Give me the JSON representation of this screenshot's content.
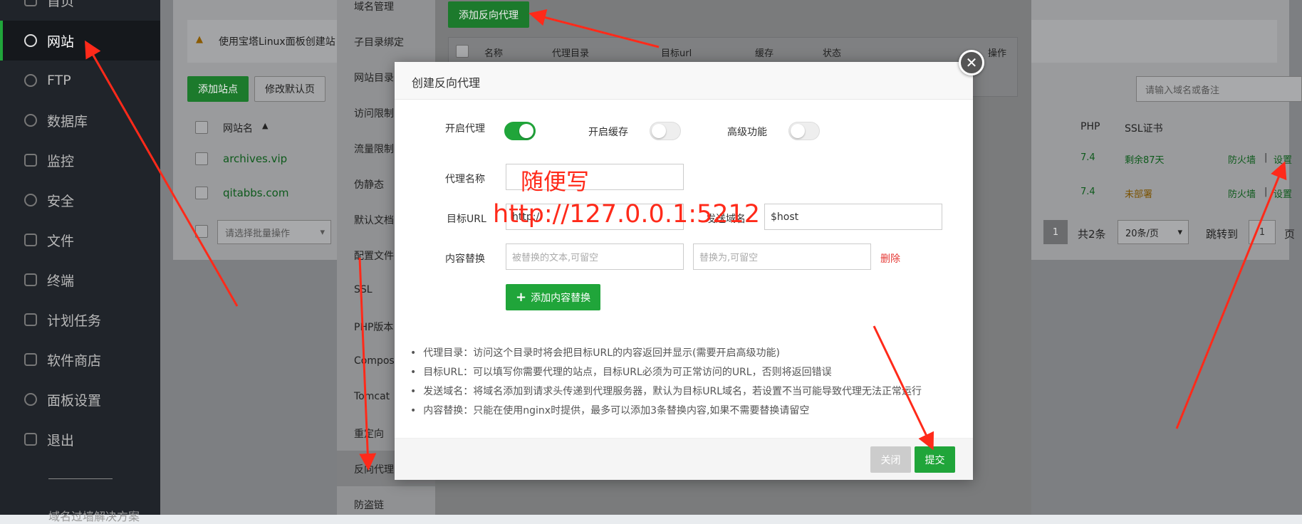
{
  "sidebar": {
    "items": [
      {
        "label": "首页",
        "icon": "home-icon"
      },
      {
        "label": "网站",
        "icon": "globe-icon"
      },
      {
        "label": "FTP",
        "icon": "ftp-icon"
      },
      {
        "label": "数据库",
        "icon": "database-icon"
      },
      {
        "label": "监控",
        "icon": "monitor-icon"
      },
      {
        "label": "安全",
        "icon": "shield-icon"
      },
      {
        "label": "文件",
        "icon": "folder-icon"
      },
      {
        "label": "终端",
        "icon": "terminal-icon"
      },
      {
        "label": "计划任务",
        "icon": "calendar-icon"
      },
      {
        "label": "软件商店",
        "icon": "apps-icon"
      },
      {
        "label": "面板设置",
        "icon": "gear-icon"
      },
      {
        "label": "退出",
        "icon": "logout-icon"
      }
    ],
    "footer_text": "域名过墙解决方案"
  },
  "site_page": {
    "warning": "使用宝塔Linux面板创建站",
    "add_site": "添加站点",
    "modify_default": "修改默认页",
    "col_name": "网站名",
    "col_php": "PHP",
    "col_ssl": "SSL证书",
    "search_placeholder": "请输入域名或备注",
    "rows": [
      {
        "name": "archives.vip",
        "php": "7.4",
        "ssl": "剩余87天",
        "fw": "防火墙",
        "sep": "|",
        "set": "设置"
      },
      {
        "name": "qitabbs.com",
        "php": "7.4",
        "ssl": "未部署",
        "fw": "防火墙",
        "sep": "|",
        "set": "设置"
      }
    ],
    "batch_placeholder": "请选择批量操作",
    "page_current": "1",
    "total": "共2条",
    "per_page": "20条/页",
    "jump_to": "跳转到",
    "page_input": "1",
    "page_unit": "页"
  },
  "settings_menu": {
    "items": [
      "域名管理",
      "子目录绑定",
      "网站目录",
      "访问限制",
      "流量限制",
      "伪静态",
      "默认文档",
      "配置文件",
      "SSL",
      "PHP版本",
      "Composer",
      "Tomcat",
      "重定向",
      "反向代理",
      "防盗链"
    ]
  },
  "proxy_tab": {
    "add_button": "添加反向代理",
    "headers": [
      "名称",
      "代理目录",
      "目标url",
      "缓存",
      "状态",
      "操作"
    ]
  },
  "modal": {
    "title": "创建反向代理",
    "enable_proxy": "开启代理",
    "enable_cache": "开启缓存",
    "advanced": "高级功能",
    "toggles": {
      "proxy": true,
      "cache": false,
      "advanced": false
    },
    "name_label": "代理名称",
    "name_value": "",
    "target_label": "目标URL",
    "target_value": "http://",
    "send_domain_label": "发送域名",
    "send_domain_value": "$host",
    "replace_label": "内容替换",
    "replace_from_placeholder": "被替换的文本,可留空",
    "replace_to_placeholder": "替换为,可留空",
    "delete": "删除",
    "add_replace": "添加内容替换",
    "notes": [
      "代理目录：访问这个目录时将会把目标URL的内容返回并显示(需要开启高级功能)",
      "目标URL：可以填写你需要代理的站点，目标URL必须为可正常访问的URL，否则将返回错误",
      "发送域名：将域名添加到请求头传递到代理服务器，默认为目标URL域名，若设置不当可能导致代理无法正常运行",
      "内容替换：只能在使用nginx时提供，最多可以添加3条替换内容,如果不需要替换请留空"
    ],
    "close": "关闭",
    "submit": "提交"
  },
  "annotations": {
    "name_hint": "随便写",
    "url_hint": "http://127.0.0.1:5212",
    "color": "#ff2a1a"
  }
}
